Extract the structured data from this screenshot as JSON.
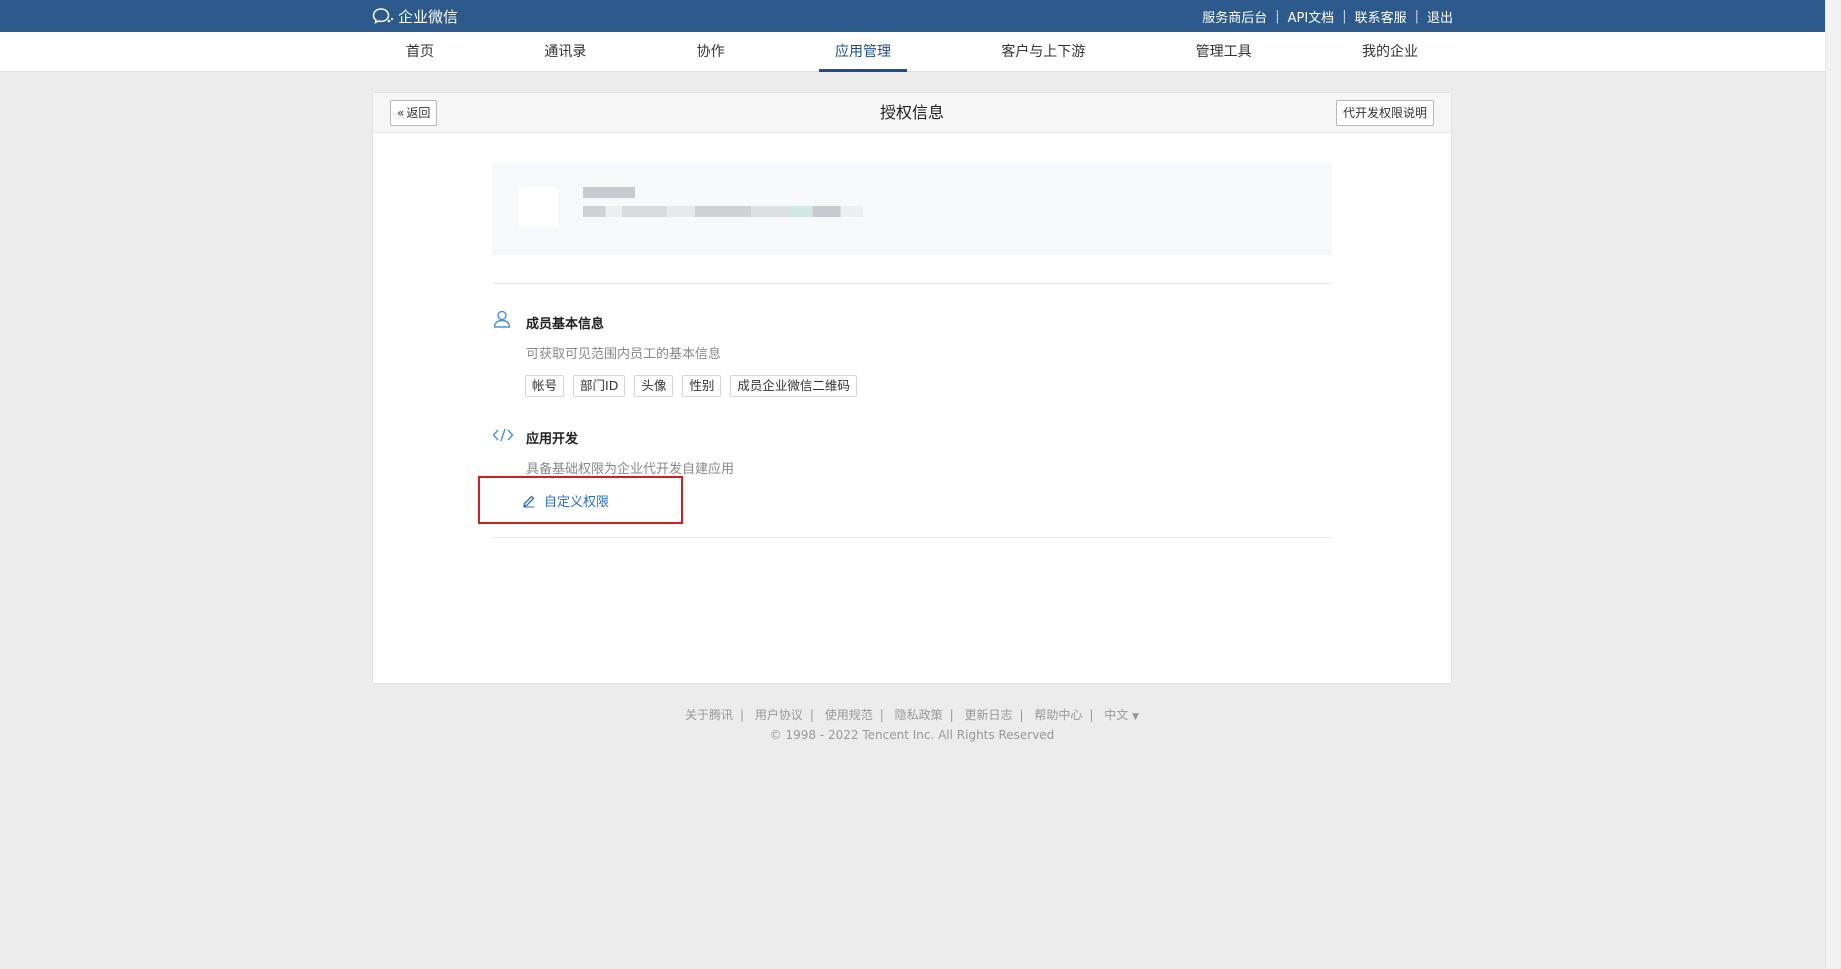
{
  "brand": {
    "name": "企业微信"
  },
  "top_links": [
    "服务商后台",
    "API文档",
    "联系客服",
    "退出"
  ],
  "nav": {
    "items": [
      "首页",
      "通讯录",
      "协作",
      "应用管理",
      "客户与上下游",
      "管理工具",
      "我的企业"
    ],
    "active_index": 3
  },
  "card": {
    "back_label": "返回",
    "title": "授权信息",
    "explain_label": "代开发权限说明"
  },
  "sections": {
    "member": {
      "title": "成员基本信息",
      "desc": "可获取可见范围内员工的基本信息",
      "tags": [
        "帐号",
        "部门ID",
        "头像",
        "性别",
        "成员企业微信二维码"
      ]
    },
    "dev": {
      "title": "应用开发",
      "desc": "具备基础权限为企业代开发自建应用",
      "custom_label": "自定义权限"
    }
  },
  "footer": {
    "links": [
      "关于腾讯",
      "用户协议",
      "使用规范",
      "隐私政策",
      "更新日志",
      "帮助中心"
    ],
    "lang": "中文",
    "copyright": "© 1998 - 2022 Tencent Inc. All Rights Reserved"
  },
  "colors": {
    "topbar": "#2d5a8c",
    "nav_active": "#1f4f86",
    "link": "#2b6cc4",
    "highlight": "#d21e1e"
  }
}
